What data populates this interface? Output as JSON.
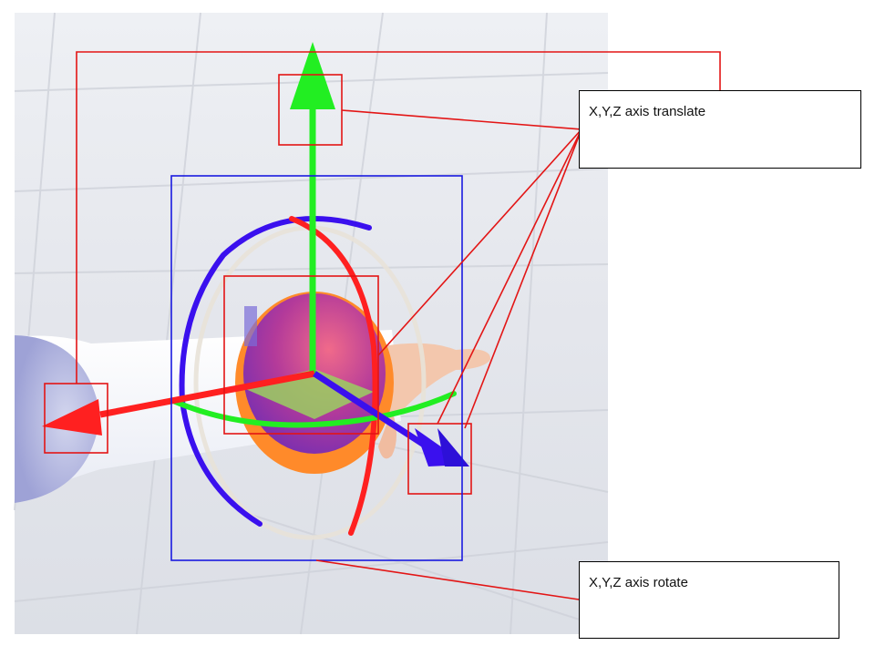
{
  "annotations": {
    "translate_label": "X,Y,Z axis translate",
    "rotate_label": "X,Y,Z axis rotate"
  },
  "colors": {
    "x_axis": "#ff2020",
    "y_axis": "#22ee22",
    "z_axis": "#3a10ee",
    "translate_highlight": "#e31515",
    "rotate_highlight": "#1a1ae0",
    "viewport_background": "#e6e8ee"
  }
}
